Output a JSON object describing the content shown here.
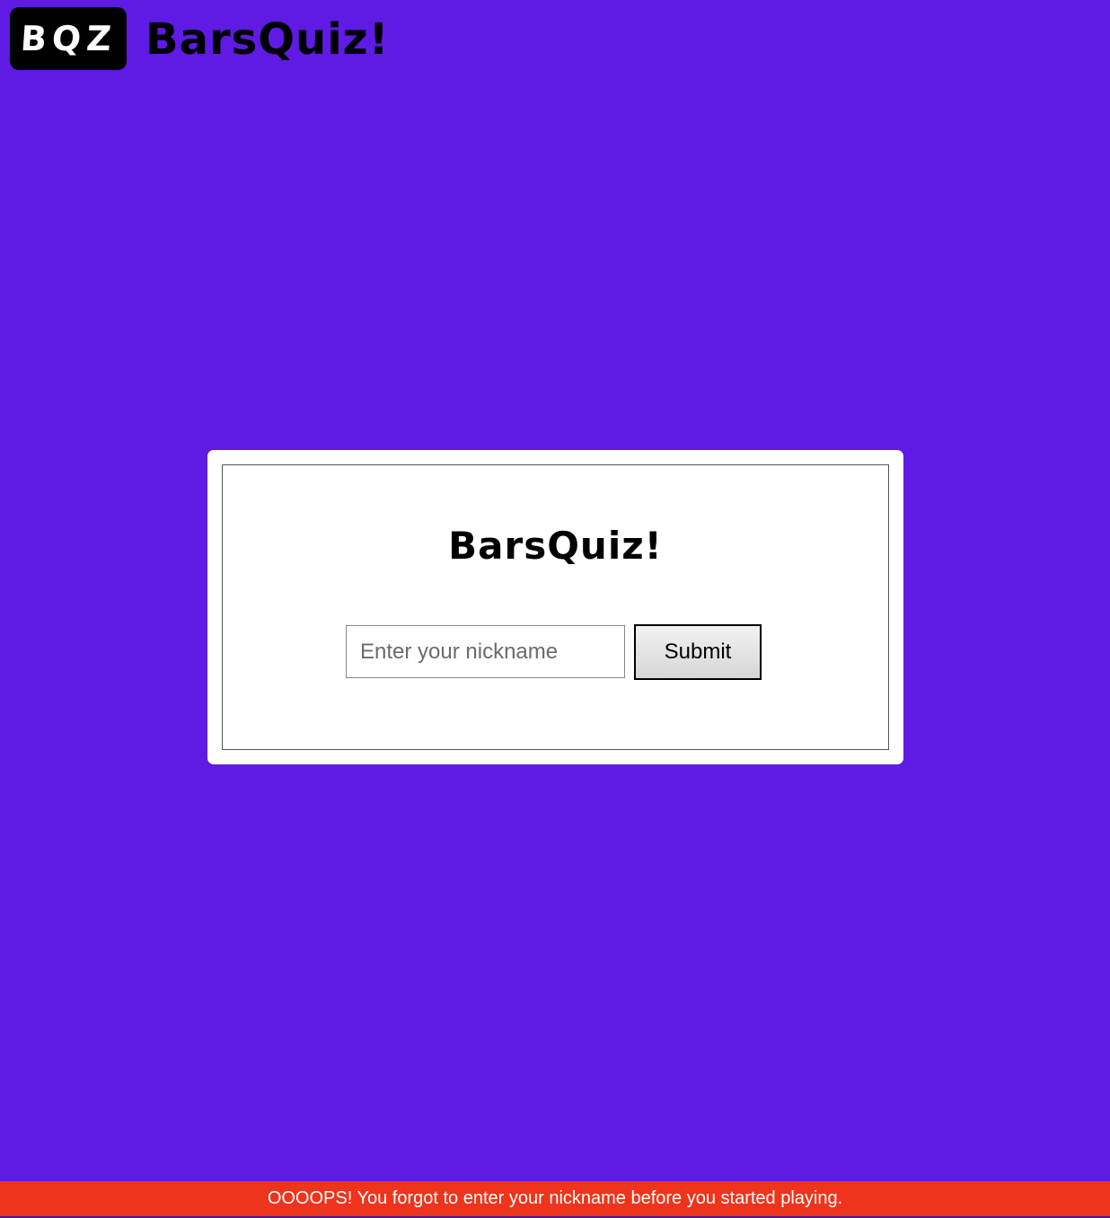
{
  "header": {
    "logo_badge_text": "BQZ",
    "brand_name": "BarsQuiz!"
  },
  "card": {
    "logo_text": "BarsQuiz!",
    "nickname_input": {
      "value": "",
      "placeholder": "Enter your nickname"
    },
    "submit_label": "Submit"
  },
  "error_banner": {
    "message": "OOOOPS! You forgot to enter your nickname before you started playing."
  },
  "colors": {
    "background": "#5f1be3",
    "error": "#ee341c",
    "card": "#ffffff"
  }
}
